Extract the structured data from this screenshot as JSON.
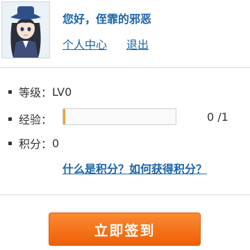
{
  "user": {
    "greeting": "您好，侄霏的邪恶"
  },
  "links": {
    "profile": "个人中心",
    "logout": "退出"
  },
  "stats": {
    "level_label": "等级：",
    "level_value": "LV0",
    "exp_label": "经验：",
    "exp_count": "0 /1",
    "exp_progress_fraction": 0.0,
    "points_label": "积分：",
    "points_value": "0"
  },
  "help_link": "什么是积分？如何获得积分？",
  "checkin_button": "立即签到",
  "colors": {
    "link": "#1a63a8",
    "button": "#f47216",
    "progress": "#e8a23a"
  },
  "icons": {
    "avatar": "anime-girl-avatar"
  }
}
